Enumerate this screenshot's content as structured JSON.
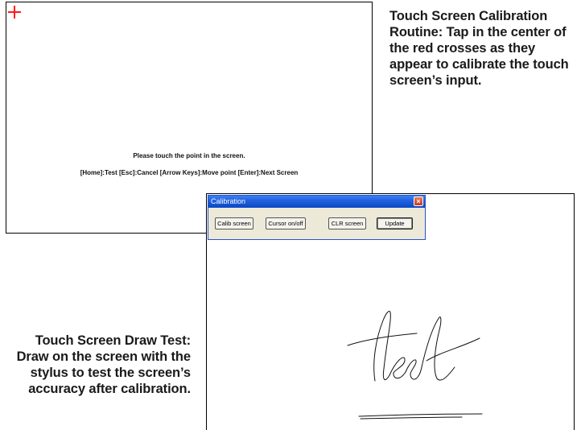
{
  "calibration_screen": {
    "line1": "Please touch the point in the screen.",
    "line2": "[Home]:Test  [Esc]:Cancel  [Arrow Keys]:Move point  [Enter]:Next Screen",
    "cross_color": "#ff1a1a"
  },
  "captions": {
    "calibration": "Touch Screen Calibration Routine: Tap in the center of the red crosses as they appear to calibrate the touch screen’s input.",
    "draw_test": "Touch Screen Draw Test: Draw on the screen with the stylus to test the screen’s accuracy after calibration."
  },
  "dialog": {
    "title": "Calibration",
    "buttons": {
      "calib": "Calib screen",
      "cursor": "Cursor on/off",
      "clr": "CLR screen",
      "update": "Update"
    }
  }
}
